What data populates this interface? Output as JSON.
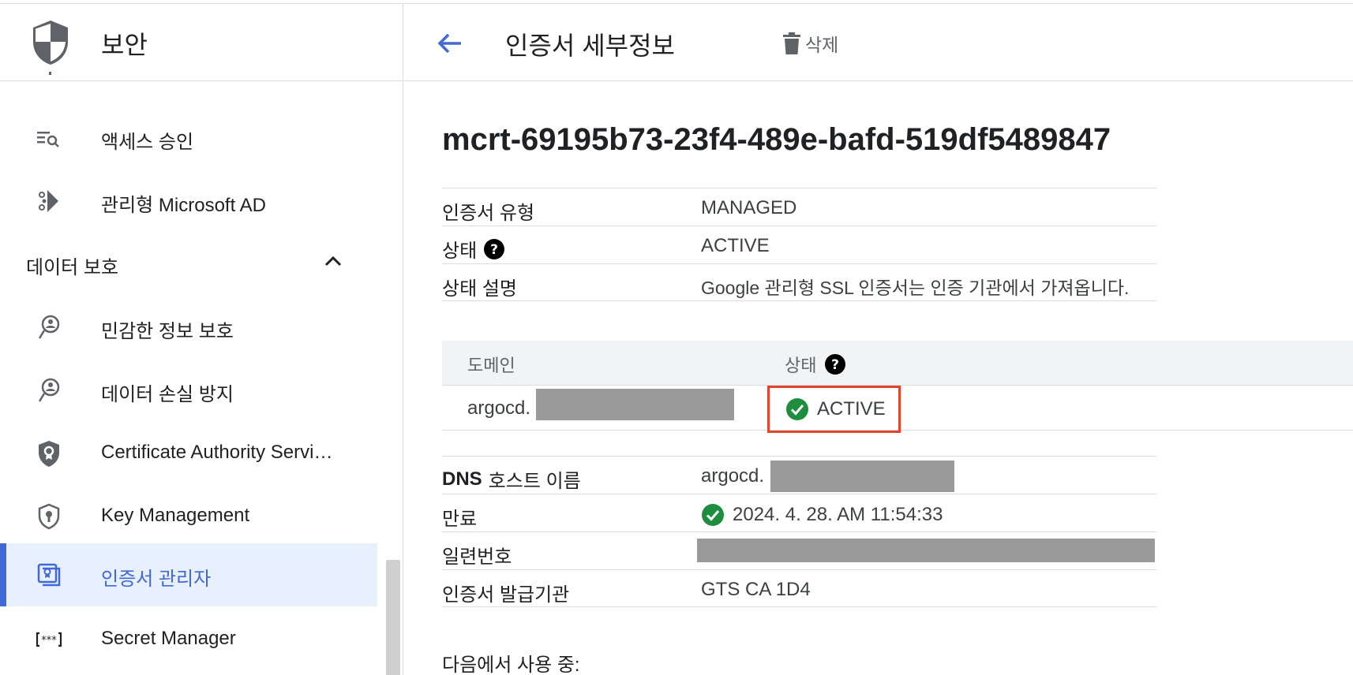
{
  "sidebar": {
    "title": "보안",
    "section": {
      "label": "데이터 보호"
    },
    "items_top": [
      {
        "label": "액세스 승인",
        "icon": "list-search-icon"
      },
      {
        "label": "관리형 Microsoft AD",
        "icon": "directory-icon"
      }
    ],
    "items": [
      {
        "label": "민감한 정보 보호",
        "icon": "sensitive-data-icon"
      },
      {
        "label": "데이터 손실 방지",
        "icon": "dlp-icon"
      },
      {
        "label": "Certificate Authority Servi…",
        "icon": "ca-shield-icon"
      },
      {
        "label": "Key Management",
        "icon": "key-shield-icon"
      },
      {
        "label": "인증서 관리자",
        "icon": "certificate-icon",
        "selected": true
      },
      {
        "label": "Secret Manager",
        "icon": "secret-icon"
      }
    ]
  },
  "header": {
    "title": "인증서 세부정보",
    "delete_label": "삭제"
  },
  "certificate": {
    "name": "mcrt-69195b73-23f4-489e-bafd-519df5489847",
    "details": [
      {
        "key": "인증서 유형",
        "value": "MANAGED"
      },
      {
        "key": "상태",
        "value": "ACTIVE"
      },
      {
        "key": "상태 설명",
        "value": "Google 관리형 SSL 인증서는 인증 기관에서 가져옵니다."
      }
    ],
    "domain_table": {
      "col_domain": "도메인",
      "col_status": "상태",
      "rows": [
        {
          "domain": "argocd.",
          "status": "ACTIVE"
        }
      ]
    },
    "more": [
      {
        "key": "DNS 호스트 이름",
        "value": "argocd."
      },
      {
        "key": "만료",
        "value": "2024. 4. 28. AM 11:54:33"
      },
      {
        "key": "일련번호",
        "value": ""
      },
      {
        "key": "인증서 발급기관",
        "value": "GTS CA 1D4"
      }
    ],
    "in_use_label": "다음에서 사용 중:"
  },
  "colors": {
    "accent": "#4169d6",
    "success": "#1e8e3e",
    "highlight": "#e0462f"
  }
}
